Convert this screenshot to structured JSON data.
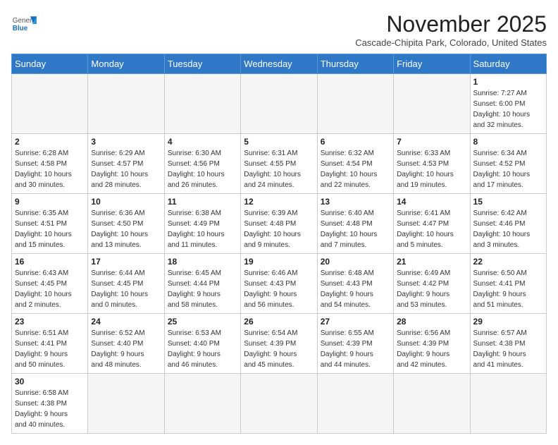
{
  "header": {
    "logo_general": "General",
    "logo_blue": "Blue",
    "month_title": "November 2025",
    "subtitle": "Cascade-Chipita Park, Colorado, United States"
  },
  "days_of_week": [
    "Sunday",
    "Monday",
    "Tuesday",
    "Wednesday",
    "Thursday",
    "Friday",
    "Saturday"
  ],
  "weeks": [
    [
      {
        "day": "",
        "info": ""
      },
      {
        "day": "",
        "info": ""
      },
      {
        "day": "",
        "info": ""
      },
      {
        "day": "",
        "info": ""
      },
      {
        "day": "",
        "info": ""
      },
      {
        "day": "",
        "info": ""
      },
      {
        "day": "1",
        "info": "Sunrise: 7:27 AM\nSunset: 6:00 PM\nDaylight: 10 hours\nand 32 minutes."
      }
    ],
    [
      {
        "day": "2",
        "info": "Sunrise: 6:28 AM\nSunset: 4:58 PM\nDaylight: 10 hours\nand 30 minutes."
      },
      {
        "day": "3",
        "info": "Sunrise: 6:29 AM\nSunset: 4:57 PM\nDaylight: 10 hours\nand 28 minutes."
      },
      {
        "day": "4",
        "info": "Sunrise: 6:30 AM\nSunset: 4:56 PM\nDaylight: 10 hours\nand 26 minutes."
      },
      {
        "day": "5",
        "info": "Sunrise: 6:31 AM\nSunset: 4:55 PM\nDaylight: 10 hours\nand 24 minutes."
      },
      {
        "day": "6",
        "info": "Sunrise: 6:32 AM\nSunset: 4:54 PM\nDaylight: 10 hours\nand 22 minutes."
      },
      {
        "day": "7",
        "info": "Sunrise: 6:33 AM\nSunset: 4:53 PM\nDaylight: 10 hours\nand 19 minutes."
      },
      {
        "day": "8",
        "info": "Sunrise: 6:34 AM\nSunset: 4:52 PM\nDaylight: 10 hours\nand 17 minutes."
      }
    ],
    [
      {
        "day": "9",
        "info": "Sunrise: 6:35 AM\nSunset: 4:51 PM\nDaylight: 10 hours\nand 15 minutes."
      },
      {
        "day": "10",
        "info": "Sunrise: 6:36 AM\nSunset: 4:50 PM\nDaylight: 10 hours\nand 13 minutes."
      },
      {
        "day": "11",
        "info": "Sunrise: 6:38 AM\nSunset: 4:49 PM\nDaylight: 10 hours\nand 11 minutes."
      },
      {
        "day": "12",
        "info": "Sunrise: 6:39 AM\nSunset: 4:48 PM\nDaylight: 10 hours\nand 9 minutes."
      },
      {
        "day": "13",
        "info": "Sunrise: 6:40 AM\nSunset: 4:48 PM\nDaylight: 10 hours\nand 7 minutes."
      },
      {
        "day": "14",
        "info": "Sunrise: 6:41 AM\nSunset: 4:47 PM\nDaylight: 10 hours\nand 5 minutes."
      },
      {
        "day": "15",
        "info": "Sunrise: 6:42 AM\nSunset: 4:46 PM\nDaylight: 10 hours\nand 3 minutes."
      }
    ],
    [
      {
        "day": "16",
        "info": "Sunrise: 6:43 AM\nSunset: 4:45 PM\nDaylight: 10 hours\nand 2 minutes."
      },
      {
        "day": "17",
        "info": "Sunrise: 6:44 AM\nSunset: 4:45 PM\nDaylight: 10 hours\nand 0 minutes."
      },
      {
        "day": "18",
        "info": "Sunrise: 6:45 AM\nSunset: 4:44 PM\nDaylight: 9 hours\nand 58 minutes."
      },
      {
        "day": "19",
        "info": "Sunrise: 6:46 AM\nSunset: 4:43 PM\nDaylight: 9 hours\nand 56 minutes."
      },
      {
        "day": "20",
        "info": "Sunrise: 6:48 AM\nSunset: 4:43 PM\nDaylight: 9 hours\nand 54 minutes."
      },
      {
        "day": "21",
        "info": "Sunrise: 6:49 AM\nSunset: 4:42 PM\nDaylight: 9 hours\nand 53 minutes."
      },
      {
        "day": "22",
        "info": "Sunrise: 6:50 AM\nSunset: 4:41 PM\nDaylight: 9 hours\nand 51 minutes."
      }
    ],
    [
      {
        "day": "23",
        "info": "Sunrise: 6:51 AM\nSunset: 4:41 PM\nDaylight: 9 hours\nand 50 minutes."
      },
      {
        "day": "24",
        "info": "Sunrise: 6:52 AM\nSunset: 4:40 PM\nDaylight: 9 hours\nand 48 minutes."
      },
      {
        "day": "25",
        "info": "Sunrise: 6:53 AM\nSunset: 4:40 PM\nDaylight: 9 hours\nand 46 minutes."
      },
      {
        "day": "26",
        "info": "Sunrise: 6:54 AM\nSunset: 4:39 PM\nDaylight: 9 hours\nand 45 minutes."
      },
      {
        "day": "27",
        "info": "Sunrise: 6:55 AM\nSunset: 4:39 PM\nDaylight: 9 hours\nand 44 minutes."
      },
      {
        "day": "28",
        "info": "Sunrise: 6:56 AM\nSunset: 4:39 PM\nDaylight: 9 hours\nand 42 minutes."
      },
      {
        "day": "29",
        "info": "Sunrise: 6:57 AM\nSunset: 4:38 PM\nDaylight: 9 hours\nand 41 minutes."
      }
    ],
    [
      {
        "day": "30",
        "info": "Sunrise: 6:58 AM\nSunset: 4:38 PM\nDaylight: 9 hours\nand 40 minutes."
      },
      {
        "day": "",
        "info": ""
      },
      {
        "day": "",
        "info": ""
      },
      {
        "day": "",
        "info": ""
      },
      {
        "day": "",
        "info": ""
      },
      {
        "day": "",
        "info": ""
      },
      {
        "day": "",
        "info": ""
      }
    ]
  ]
}
